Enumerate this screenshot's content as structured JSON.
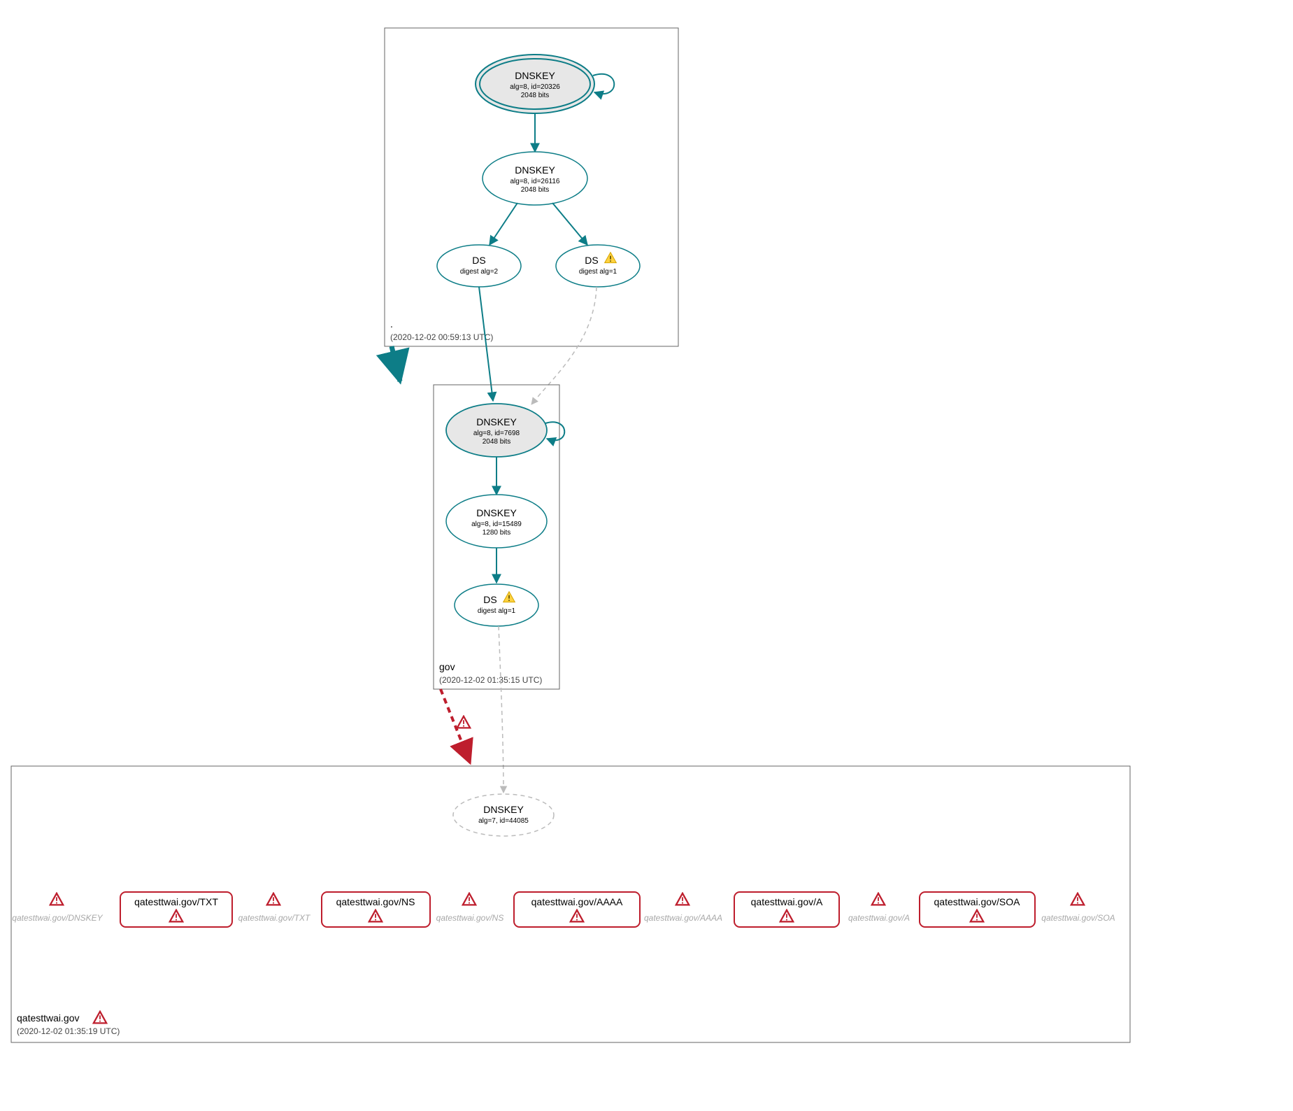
{
  "zones": {
    "root": {
      "name": ".",
      "ts": "(2020-12-02 00:59:13 UTC)"
    },
    "gov": {
      "name": "gov",
      "ts": "(2020-12-02 01:35:15 UTC)"
    },
    "leaf": {
      "name": "qatesttwai.gov",
      "ts": "(2020-12-02 01:35:19 UTC)"
    }
  },
  "root": {
    "ksk": {
      "t": "DNSKEY",
      "l1": "alg=8, id=20326",
      "l2": "2048 bits"
    },
    "zsk": {
      "t": "DNSKEY",
      "l1": "alg=8, id=26116",
      "l2": "2048 bits"
    },
    "ds1": {
      "t": "DS",
      "l1": "digest alg=2"
    },
    "ds2": {
      "t": "DS",
      "l1": "digest alg=1"
    }
  },
  "gov": {
    "ksk": {
      "t": "DNSKEY",
      "l1": "alg=8, id=7698",
      "l2": "2048 bits"
    },
    "zsk": {
      "t": "DNSKEY",
      "l1": "alg=8, id=15489",
      "l2": "1280 bits"
    },
    "ds": {
      "t": "DS",
      "l1": "digest alg=1"
    }
  },
  "leaf": {
    "key": {
      "t": "DNSKEY",
      "l1": "alg=7, id=44085"
    },
    "ghost": [
      "qatesttwai.gov/DNSKEY",
      "qatesttwai.gov/TXT",
      "qatesttwai.gov/NS",
      "qatesttwai.gov/AAAA",
      "qatesttwai.gov/A",
      "qatesttwai.gov/SOA"
    ],
    "rrset": [
      "qatesttwai.gov/TXT",
      "qatesttwai.gov/NS",
      "qatesttwai.gov/AAAA",
      "qatesttwai.gov/A",
      "qatesttwai.gov/SOA"
    ]
  }
}
